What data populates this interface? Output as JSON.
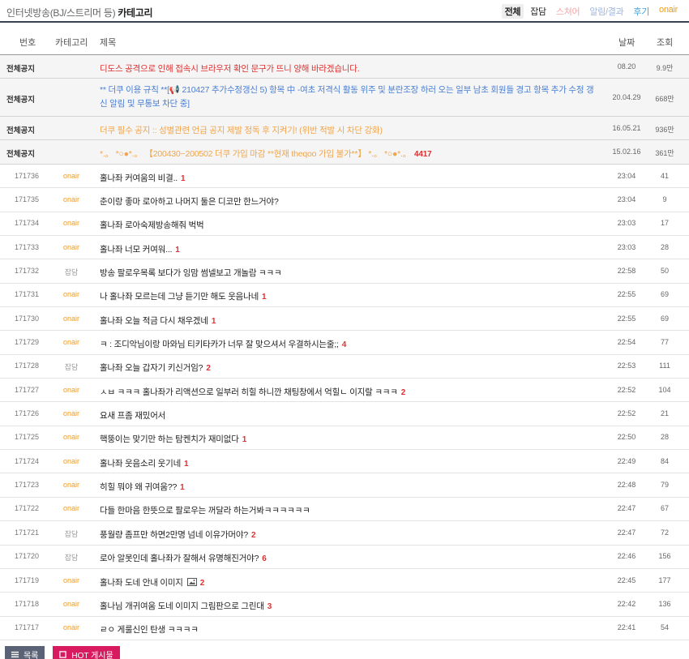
{
  "board": {
    "title_prefix": "인터넷방송(BJ/스트리머 등)",
    "title_category": " 카테고리"
  },
  "category_tabs": [
    {
      "label": "전체",
      "color": "#222222"
    },
    {
      "label": "잡담",
      "color": "#222222"
    },
    {
      "label": "스쳐어",
      "color": "#f4a6a6"
    },
    {
      "label": "알림/결과",
      "color": "#9fb6dd"
    },
    {
      "label": "후기",
      "color": "#4aa3d8"
    },
    {
      "label": "onair",
      "color": "#f39c12"
    }
  ],
  "columns": {
    "no": "번호",
    "category": "카테고리",
    "title": "제목",
    "date": "날짜",
    "views": "조회"
  },
  "notices": [
    {
      "no": "전체공지",
      "title": "디도스 공격으로 인해 접속시 브라우저 확인 문구가 뜨니 양해 바라겠습니다.",
      "date": "08.20",
      "views": "9.9만",
      "color": "red"
    },
    {
      "no": "전체공지",
      "title": "** 더쿠 이용 규칙 **[📢 210427 추가수정갱신 5) 항목 中 -여초 저격식 활동 위주 및 분란조장 하러 오는 일부 남초 회원들 경고 항목 추가 수정 갱신 알림 및 무통보 차단 중]",
      "date": "20.04.29",
      "views": "668만",
      "color": "blue"
    },
    {
      "no": "전체공지",
      "title": "더쿠 필수 공지 :: 성별관련 언급 공지 제발 정독 후 지켜기! (위반 적발 시 차단 강화)",
      "date": "16.05.21",
      "views": "936만",
      "color": "orange"
    },
    {
      "no": "전체공지",
      "title": "*.。 *○●*.。 【200430~200502 더쿠 가입 마감 **현재 theqoo 가입 불가**】 *.。 *○●*.。",
      "comment": "4417",
      "date": "15.02.16",
      "views": "361만",
      "color": "orange"
    }
  ],
  "posts": [
    {
      "no": "171736",
      "category": "onair",
      "title": "홀나좌 커여움의 비결..",
      "comment": "1",
      "date": "23:04",
      "views": "41"
    },
    {
      "no": "171735",
      "category": "onair",
      "title": "춘이랑 좋마 로아하고 나머지 둘은 디코만 한느거야?",
      "comment": "",
      "date": "23:04",
      "views": "9"
    },
    {
      "no": "171734",
      "category": "onair",
      "title": "홀나좌 로아숙제방송해줘 벅벅",
      "comment": "",
      "date": "23:03",
      "views": "17"
    },
    {
      "no": "171733",
      "category": "onair",
      "title": "홀나좌 너모 커여워...",
      "comment": "1",
      "date": "23:03",
      "views": "28"
    },
    {
      "no": "171732",
      "category": "잡담",
      "title": "방송 팔로우목록 보다가 잉맘 썸넬보고 개놀람 ㅋㅋㅋ",
      "comment": "",
      "date": "22:58",
      "views": "50"
    },
    {
      "no": "171731",
      "category": "onair",
      "title": "나 홀나좌 모르는데 그냥 듣기만 해도 웃음나네",
      "comment": "1",
      "date": "22:55",
      "views": "69"
    },
    {
      "no": "171730",
      "category": "onair",
      "title": "홀나좌 오늘 적금 다시 채우겠네",
      "comment": "1",
      "date": "22:55",
      "views": "69"
    },
    {
      "no": "171729",
      "category": "onair",
      "title": "ㅋ : 조디악님이랑 마와님 티키타카가 너무 잘 맞으셔서 우결하시는줄;;",
      "comment": "4",
      "date": "22:54",
      "views": "77"
    },
    {
      "no": "171728",
      "category": "잡담",
      "title": "홀나좌 오늘 갑자기 키신거임?",
      "comment": "2",
      "date": "22:53",
      "views": "111"
    },
    {
      "no": "171727",
      "category": "onair",
      "title": "ㅅㅂ ㅋㅋㅋ 홀나좌가 리액션으로 일부러 히힐 하니깐 채팅창에서 억힐ㄴ 이지랄 ㅋㅋㅋ",
      "comment": "2",
      "date": "22:52",
      "views": "104"
    },
    {
      "no": "171726",
      "category": "onair",
      "title": "요새 프좀 재밌어서",
      "comment": "",
      "date": "22:52",
      "views": "21"
    },
    {
      "no": "171725",
      "category": "onair",
      "title": "핵뚱이는 맞기만 하는 탐켄치가 재미없다",
      "comment": "1",
      "date": "22:50",
      "views": "28"
    },
    {
      "no": "171724",
      "category": "onair",
      "title": "홀나좌 웃음소리 웃기네",
      "comment": "1",
      "date": "22:49",
      "views": "84"
    },
    {
      "no": "171723",
      "category": "onair",
      "title": "히힐 뭐야 왜 귀여움??",
      "comment": "1",
      "date": "22:48",
      "views": "79"
    },
    {
      "no": "171722",
      "category": "onair",
      "title": "다들 한마음 한뜻으로 팔로우는 꺼달라 하는거봐ㅋㅋㅋㅋㅋㅋ",
      "comment": "",
      "date": "22:47",
      "views": "67"
    },
    {
      "no": "171721",
      "category": "잡담",
      "title": "풍월량 좀프만 하면2만명 넘네 이유가머야?",
      "comment": "2",
      "date": "22:47",
      "views": "72"
    },
    {
      "no": "171720",
      "category": "잡담",
      "title": "로아 알못인데 홀나좌가 잘해서 유명해진거야?",
      "comment": "6",
      "date": "22:46",
      "views": "156"
    },
    {
      "no": "171719",
      "category": "onair",
      "title": "홀나좌 도네 안내 이미지",
      "image": true,
      "comment": "2",
      "date": "22:45",
      "views": "177"
    },
    {
      "no": "171718",
      "category": "onair",
      "title": "홀나님 개귀여움 도네 이미지 그림판으로 그린대",
      "comment": "3",
      "date": "22:42",
      "views": "136"
    },
    {
      "no": "171717",
      "category": "onair",
      "title": "ㄹㅇ 게룰신인 탄생 ㅋㅋㅋㅋ",
      "comment": "",
      "date": "22:41",
      "views": "54"
    }
  ],
  "footer": {
    "list_label": "목록",
    "hot_label": "HOT 게시물"
  },
  "colors": {
    "header_rule": "#3b4256",
    "onair": "#f39c12",
    "comment": "#e03131",
    "notice_bg": "#f5f5f5",
    "list_button": "#5a6275",
    "hot_button": "#d81b60"
  },
  "icons": {
    "list_button": "list-icon",
    "hot_button": "square-icon",
    "image_attachment": "image-icon"
  }
}
